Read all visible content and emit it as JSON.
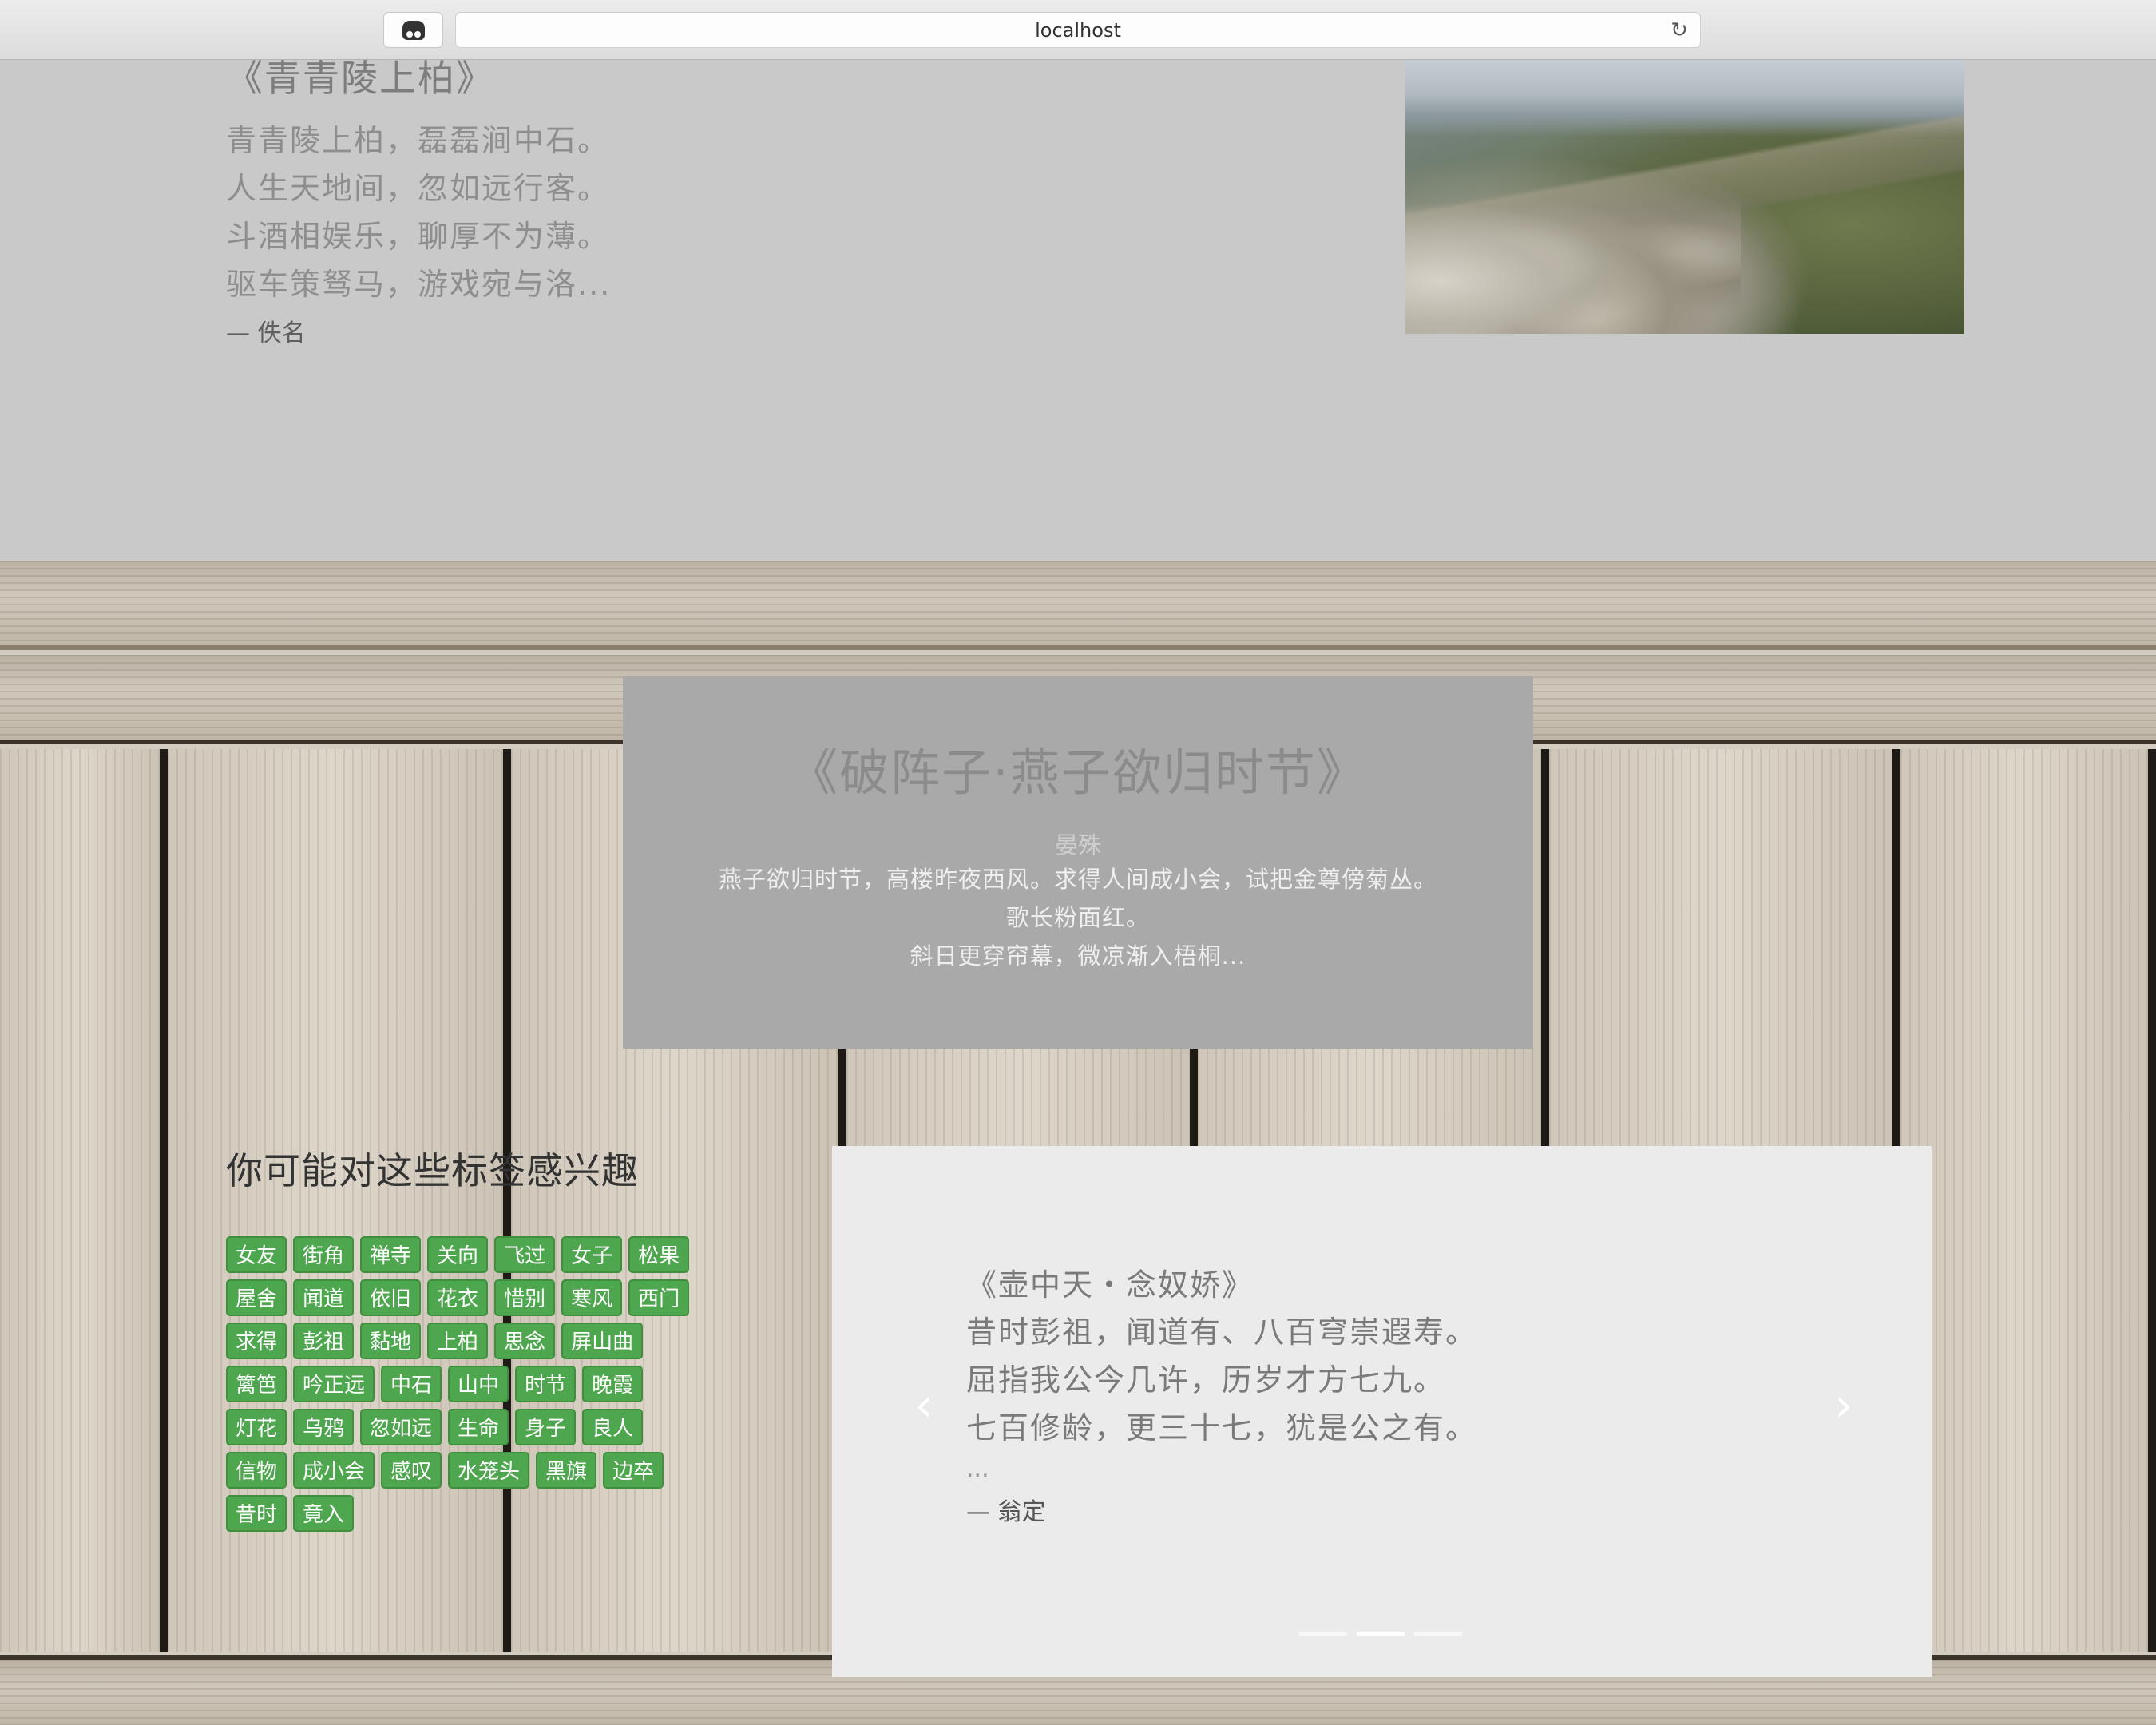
{
  "browser": {
    "url": "localhost"
  },
  "poem_top": {
    "title": "《青青陵上柏》",
    "lines": [
      "青青陵上柏，磊磊涧中石。",
      "人生天地间，忽如远行客。",
      "斗酒相娱乐，聊厚不为薄。",
      "驱车策驽马，游戏宛与洛..."
    ],
    "author": "— 佚名"
  },
  "poem_center": {
    "title": "《破阵子·燕子欲归时节》",
    "author": "晏殊",
    "lines": [
      "燕子欲归时节，高楼昨夜西风。求得人间成小会，试把金尊傍菊丛。",
      "歌长粉面红。",
      "斜日更穿帘幕，微凉渐入梧桐..."
    ]
  },
  "tags_section": {
    "title": "你可能对这些标签感兴趣",
    "tags": [
      "女友",
      "街角",
      "禅寺",
      "关向",
      "飞过",
      "女子",
      "松果",
      "屋舍",
      "闻道",
      "依旧",
      "花衣",
      "惜别",
      "寒风",
      "西门",
      "求得",
      "彭祖",
      "黏地",
      "上柏",
      "思念",
      "屏山曲",
      "篱笆",
      "吟正远",
      "中石",
      "山中",
      "时节",
      "晚霞",
      "灯花",
      "乌鸦",
      "忽如远",
      "生命",
      "身子",
      "良人",
      "信物",
      "成小会",
      "感叹",
      "水笼头",
      "黑旗",
      "边卒",
      "昔时",
      "竟入"
    ]
  },
  "carousel": {
    "title": "《壶中天・念奴娇》",
    "lines": [
      "昔时彭祖，闻道有、八百穹崇遐寿。",
      "屈指我公今几许，历岁才方七九。",
      "七百修龄，更三十七，犹是公之有。"
    ],
    "ellipsis": "...",
    "author": "— 翁定",
    "prev": "‹",
    "next": "›"
  }
}
